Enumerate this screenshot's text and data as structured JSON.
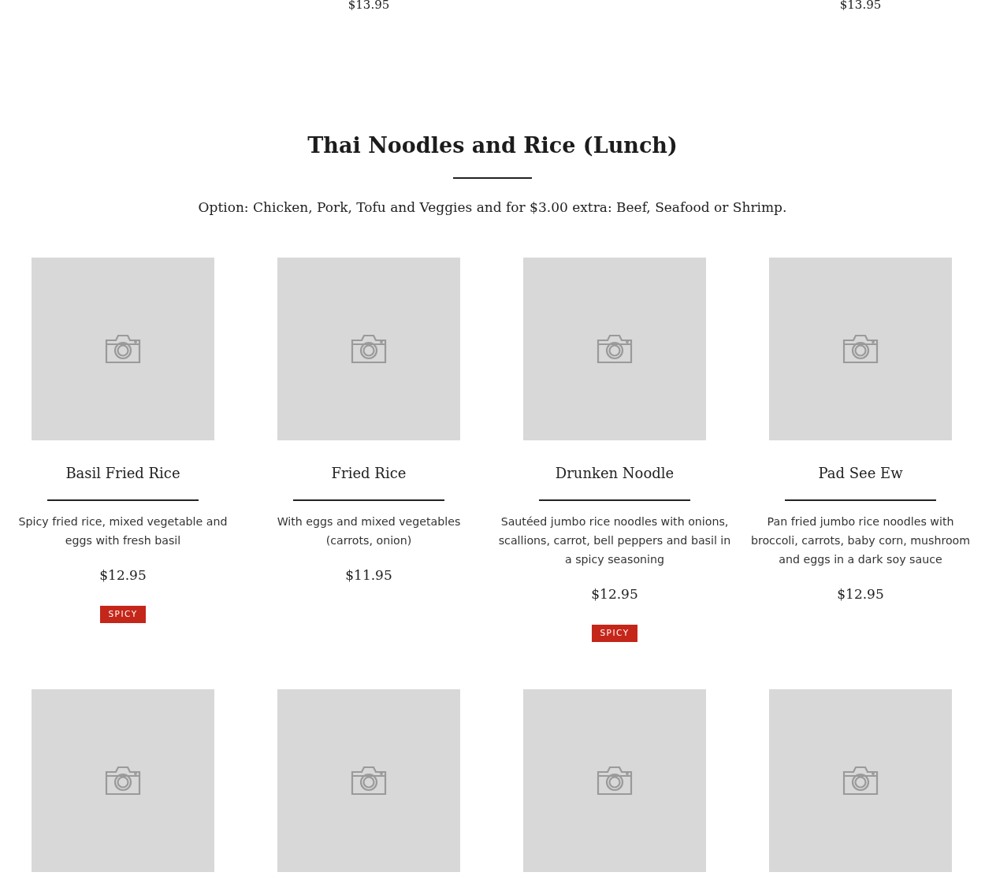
{
  "previous_row": [
    {
      "kind": "blank"
    },
    {
      "kind": "price",
      "price": "$13.95"
    },
    {
      "kind": "blank"
    },
    {
      "kind": "price",
      "price": "$13.95"
    }
  ],
  "section": {
    "title": "Thai Noodles and Rice (Lunch)",
    "note": "Option: Chicken, Pork, Tofu and Veggies and for $3.00 extra: Beef, Seafood or Shrimp."
  },
  "items": [
    {
      "kind": "dish",
      "name": "Basil Fried Rice",
      "description": "Spicy fried rice, mixed vegetable and eggs with fresh basil",
      "price": "$12.95",
      "badge": "SPICY"
    },
    {
      "kind": "dish",
      "name": "Fried Rice",
      "description": "With eggs and mixed vegetables (carrots, onion)",
      "price": "$11.95"
    },
    {
      "kind": "dish",
      "name": "Drunken Noodle",
      "description": "Sautéed jumbo rice noodles with onions, scallions, carrot, bell peppers and basil in a spicy seasoning",
      "price": "$12.95",
      "badge": "SPICY"
    },
    {
      "kind": "dish",
      "name": "Pad See Ew",
      "description": "Pan fried jumbo rice noodles with broccoli, carrots, baby corn, mushroom and eggs in a dark soy sauce",
      "price": "$12.95"
    },
    {
      "kind": "picture"
    },
    {
      "kind": "picture"
    },
    {
      "kind": "picture"
    },
    {
      "kind": "picture"
    }
  ]
}
